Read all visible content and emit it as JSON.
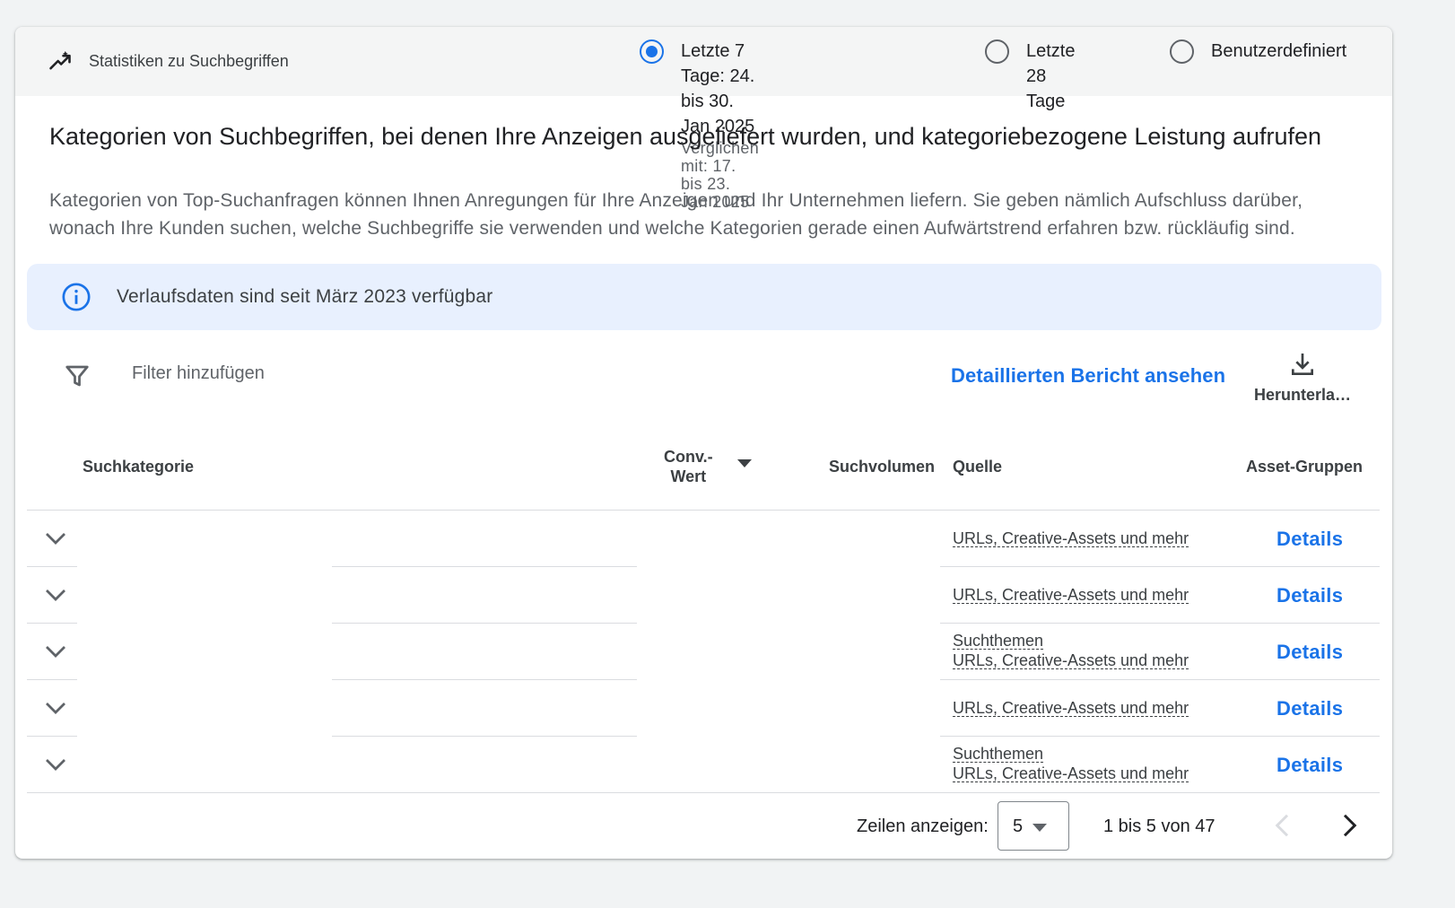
{
  "header": {
    "title": "Statistiken zu Suchbegriffen",
    "radios": [
      {
        "label": "Letzte 7 Tage: 24. bis 30. Jan 2025",
        "sub": "Verglichen mit: 17. bis 23. Jan 2025",
        "checked": true
      },
      {
        "label": "Letzte 28 Tage",
        "checked": false
      },
      {
        "label": "Benutzerdefiniert",
        "checked": false
      }
    ]
  },
  "main": {
    "title": "Kategorien von Suchbegriffen, bei denen Ihre Anzeigen ausgeliefert wurden, und kategoriebezogene Leistung aufrufen",
    "description": "Kategorien von Top-Suchanfragen können Ihnen Anregungen für Ihre Anzeigen und Ihr Unternehmen liefern. Sie geben nämlich Aufschluss darüber, wonach Ihre Kunden suchen, welche Suchbegriffe sie verwenden und welche Kategorien gerade einen Aufwärtstrend erfahren bzw. rückläufig sind."
  },
  "info_banner": {
    "text": "Verlaufsdaten sind seit März 2023 verfügbar"
  },
  "toolbar": {
    "filter_placeholder": "Filter hinzufügen",
    "report_link": "Detaillierten Bericht ansehen",
    "download_label": "Herunterla…"
  },
  "table": {
    "headers": {
      "category": "Suchkategorie",
      "conv_line1": "Conv.-",
      "conv_line2": "Wert",
      "volume": "Suchvolumen",
      "source": "Quelle",
      "asset_groups": "Asset-Gruppen"
    },
    "rows": [
      {
        "source": [
          "URLs, Creative-Assets und mehr"
        ],
        "details": "Details"
      },
      {
        "source": [
          "URLs, Creative-Assets und mehr"
        ],
        "details": "Details"
      },
      {
        "source": [
          "Suchthemen",
          "URLs, Creative-Assets und mehr"
        ],
        "details": "Details"
      },
      {
        "source": [
          "URLs, Creative-Assets und mehr"
        ],
        "details": "Details"
      },
      {
        "source": [
          "Suchthemen",
          "URLs, Creative-Assets und mehr"
        ],
        "details": "Details"
      }
    ]
  },
  "pagination": {
    "rows_label": "Zeilen anzeigen:",
    "rows_value": "5",
    "range": "1 bis 5 von 47"
  },
  "colors": {
    "accent": "#1a73e8",
    "banner": "#e8f0fe",
    "header_bg": "#f4f5f5"
  },
  "icons": [
    "trending-icon",
    "info-icon",
    "filter-icon",
    "download-icon",
    "chevron-down-icon",
    "chevron-left-icon",
    "chevron-right-icon"
  ]
}
